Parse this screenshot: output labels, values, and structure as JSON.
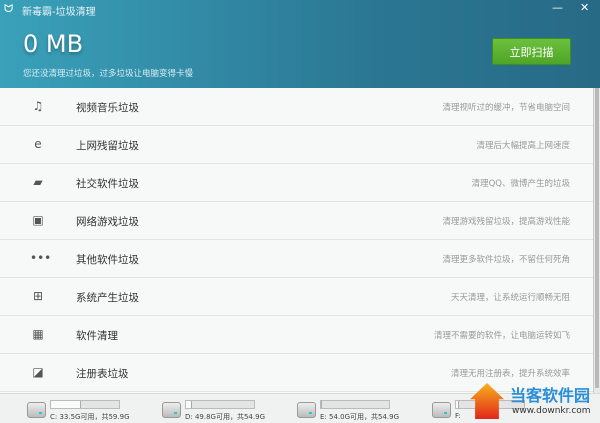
{
  "app": {
    "title": "新毒霸-垃圾清理",
    "logo_icon": "duba-logo-icon"
  },
  "window": {
    "minimize": "—",
    "close": "✕"
  },
  "summary": {
    "size": "0 MB",
    "message": "您还没清理过垃圾，过多垃圾让电脑变得卡慢",
    "scan_button": "立即扫描"
  },
  "categories": [
    {
      "icon": "music-icon",
      "glyph": "♫",
      "name": "视频音乐垃圾",
      "desc": "清理视听过的缓冲，节省电脑空间"
    },
    {
      "icon": "ie-icon",
      "glyph": "e",
      "name": "上网残留垃圾",
      "desc": "清理后大幅提高上网速度"
    },
    {
      "icon": "chat-icon",
      "glyph": "▰",
      "name": "社交软件垃圾",
      "desc": "清理QQ、微博产生的垃圾"
    },
    {
      "icon": "gamepad-icon",
      "glyph": "▣",
      "name": "网络游戏垃圾",
      "desc": "清理游戏残留垃圾，提高游戏性能"
    },
    {
      "icon": "more-icon",
      "glyph": "•••",
      "name": "其他软件垃圾",
      "desc": "清理更多软件垃圾，不留任何死角"
    },
    {
      "icon": "windows-icon",
      "glyph": "⊞",
      "name": "系统产生垃圾",
      "desc": "天天清理，让系统运行顺畅无阻"
    },
    {
      "icon": "software-icon",
      "glyph": "▦",
      "name": "软件清理",
      "desc": "清理不需要的软件，让电脑运转如飞"
    },
    {
      "icon": "registry-icon",
      "glyph": "◪",
      "name": "注册表垃圾",
      "desc": "清理无用注册表，提升系统效率"
    }
  ],
  "drives": [
    {
      "label": "C: 33.5G可用，共59.9G",
      "used_percent": 44
    },
    {
      "label": "D: 49.8G可用，共54.9G",
      "used_percent": 9
    },
    {
      "label": "E: 54.0G可用，共54.9G",
      "used_percent": 2
    },
    {
      "label": "F:",
      "used_percent": 5
    }
  ],
  "watermark": {
    "name": "当客软件园",
    "url": "www.downkr.com"
  }
}
